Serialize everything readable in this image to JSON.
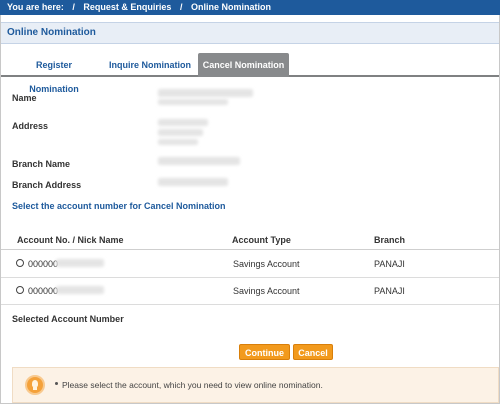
{
  "breadcrumb": {
    "prefix": "You are here:",
    "separator": "/",
    "items": [
      "Request & Enquiries",
      "Online Nomination"
    ]
  },
  "page_title": "Online Nomination",
  "tabs": [
    {
      "label": "Register Nomination",
      "active": false
    },
    {
      "label": "Inquire Nomination",
      "active": false
    },
    {
      "label": "Cancel Nomination",
      "active": true
    }
  ],
  "fields": {
    "name_label": "Name",
    "address_label": "Address",
    "branch_name_label": "Branch Name",
    "branch_address_label": "Branch Address"
  },
  "instruction": "Select the account number for Cancel Nomination",
  "table": {
    "headers": [
      "Account No. / Nick Name",
      "Account Type",
      "Branch"
    ],
    "rows": [
      {
        "account_prefix": "000000",
        "account_type": "Savings Account",
        "branch": "PANAJI"
      },
      {
        "account_prefix": "000000",
        "account_type": "Savings Account",
        "branch": "PANAJI"
      }
    ]
  },
  "selected_label": "Selected Account Number",
  "buttons": {
    "continue": "Continue",
    "cancel": "Cancel"
  },
  "note": {
    "text": "Please select the account, which you need to view online nomination."
  },
  "colors": {
    "accent": "#1e5a9c",
    "active_tab": "#888a8c",
    "button": "#f29a1d",
    "note_bg": "#fcf2e6"
  }
}
